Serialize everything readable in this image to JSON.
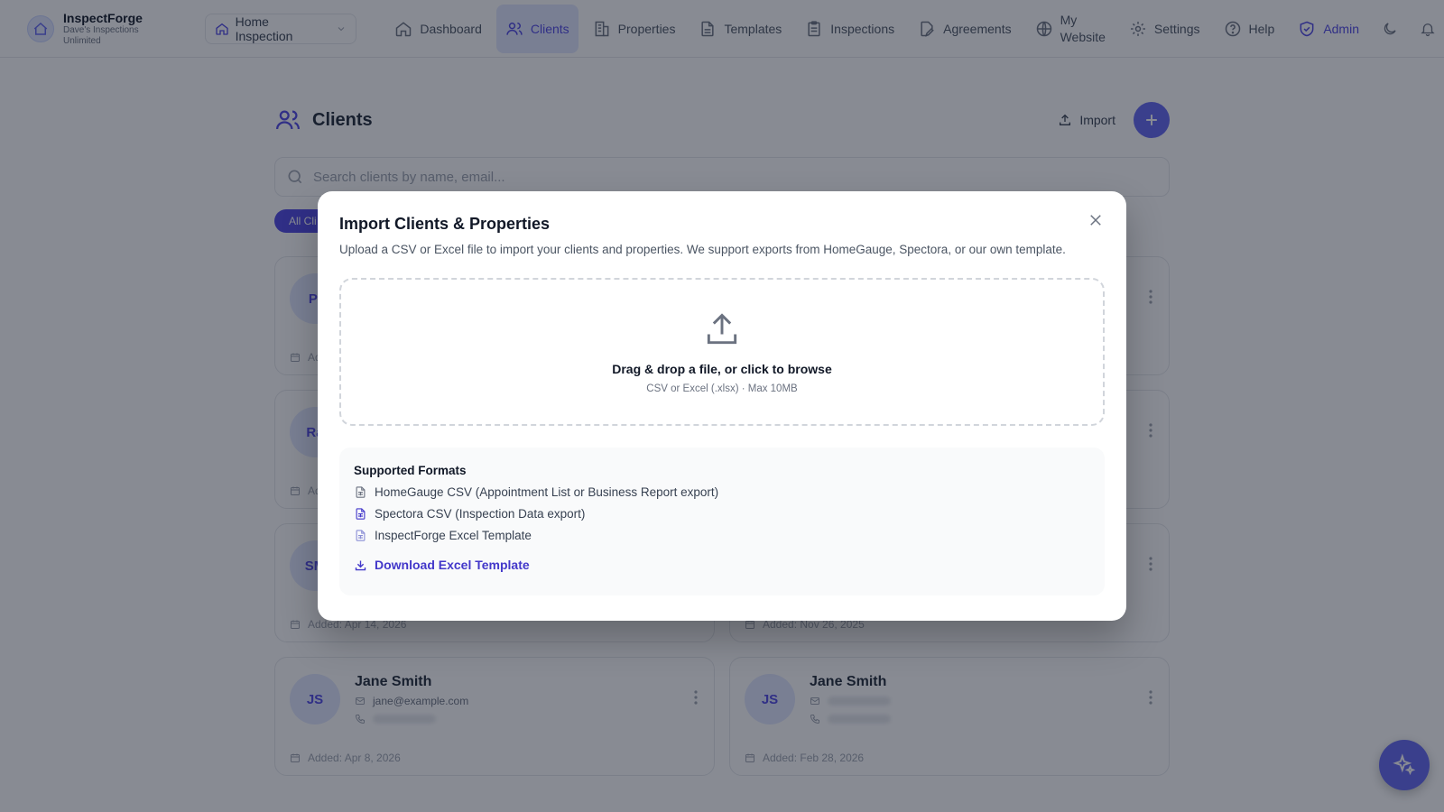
{
  "brand": {
    "name": "InspectForge",
    "subtitle": "Dave's Inspections Unlimited"
  },
  "workspace": {
    "label": "Home Inspection"
  },
  "nav": {
    "dashboard": "Dashboard",
    "clients": "Clients",
    "properties": "Properties",
    "templates": "Templates",
    "inspections": "Inspections",
    "agreements": "Agreements",
    "my_website_line1": "My",
    "my_website_line2": "Website",
    "settings": "Settings",
    "help": "Help",
    "admin": "Admin"
  },
  "page": {
    "title": "Clients",
    "import_label": "Import",
    "search_placeholder": "Search clients by name, email...",
    "filter_chip": "All Cli"
  },
  "cards": [
    {
      "initials": "Pi",
      "name": "",
      "email": "",
      "added": "Ad"
    },
    {
      "initials": "",
      "name": "",
      "email": "",
      "added": ""
    },
    {
      "initials": "Ra",
      "name": "",
      "email": "",
      "added": "Ad"
    },
    {
      "initials": "",
      "name": "",
      "email": "",
      "added": ""
    },
    {
      "initials": "SM",
      "name": "",
      "email": "",
      "added": "Added: Apr 14, 2026"
    },
    {
      "initials": "",
      "name": "",
      "email": "",
      "added": "Added: Nov 26, 2025"
    },
    {
      "initials": "JS",
      "name": "Jane Smith",
      "email": "jane@example.com",
      "added": "Added: Apr 8, 2026"
    },
    {
      "initials": "JS",
      "name": "Jane Smith",
      "email": "",
      "added": "Added: Feb 28, 2026"
    }
  ],
  "modal": {
    "title": "Import Clients & Properties",
    "description": "Upload a CSV or Excel file to import your clients and properties. We support exports from HomeGauge, Spectora, or our own template.",
    "dropzone_title": "Drag & drop a file, or click to browse",
    "dropzone_sub": "CSV or Excel (.xlsx) · Max 10MB",
    "formats_title": "Supported Formats",
    "formats": [
      "HomeGauge CSV (Appointment List or Business Report export)",
      "Spectora CSV (Inspection Data export)",
      "InspectForge Excel Template"
    ],
    "download_label": "Download Excel Template"
  },
  "colors": {
    "accent": "#4f46e5",
    "accent_light": "#e0e7ff",
    "fab": "#6366f1",
    "link": "#4338ca"
  }
}
